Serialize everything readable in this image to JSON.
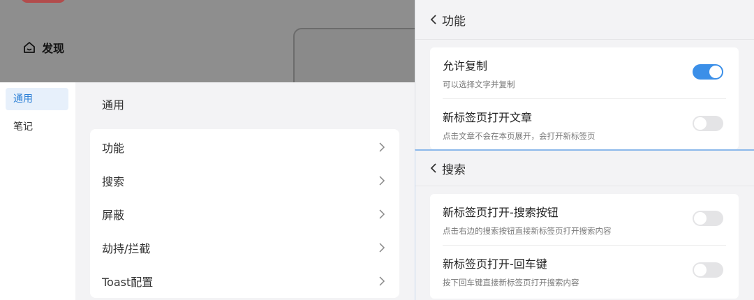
{
  "colors": {
    "accent": "#3b8fe8",
    "active_nav_text": "#2b7fd6",
    "overlay": "#8e8e8e"
  },
  "background": {
    "discover_label": "发现",
    "discover_icon": "home-icon"
  },
  "left_nav": {
    "items": [
      {
        "label": "通用",
        "active": true
      },
      {
        "label": "笔记",
        "active": false
      }
    ]
  },
  "main": {
    "title": "通用",
    "menu": [
      {
        "label": "功能"
      },
      {
        "label": "搜索"
      },
      {
        "label": "屏蔽"
      },
      {
        "label": "劫持/拦截"
      },
      {
        "label": "Toast配置"
      }
    ]
  },
  "panels": {
    "function": {
      "title": "功能",
      "settings": [
        {
          "title": "允许复制",
          "desc": "可以选择文字并复制",
          "enabled": true
        },
        {
          "title": "新标签页打开文章",
          "desc": "点击文章不会在本页展开，会打开新标签页",
          "enabled": false
        }
      ]
    },
    "search": {
      "title": "搜索",
      "settings": [
        {
          "title": "新标签页打开-搜索按钮",
          "desc": "点击右边的搜索按钮直接新标签页打开搜索内容",
          "enabled": false
        },
        {
          "title": "新标签页打开-回车键",
          "desc": "按下回车键直接新标签页打开搜索内容",
          "enabled": false
        }
      ]
    }
  }
}
